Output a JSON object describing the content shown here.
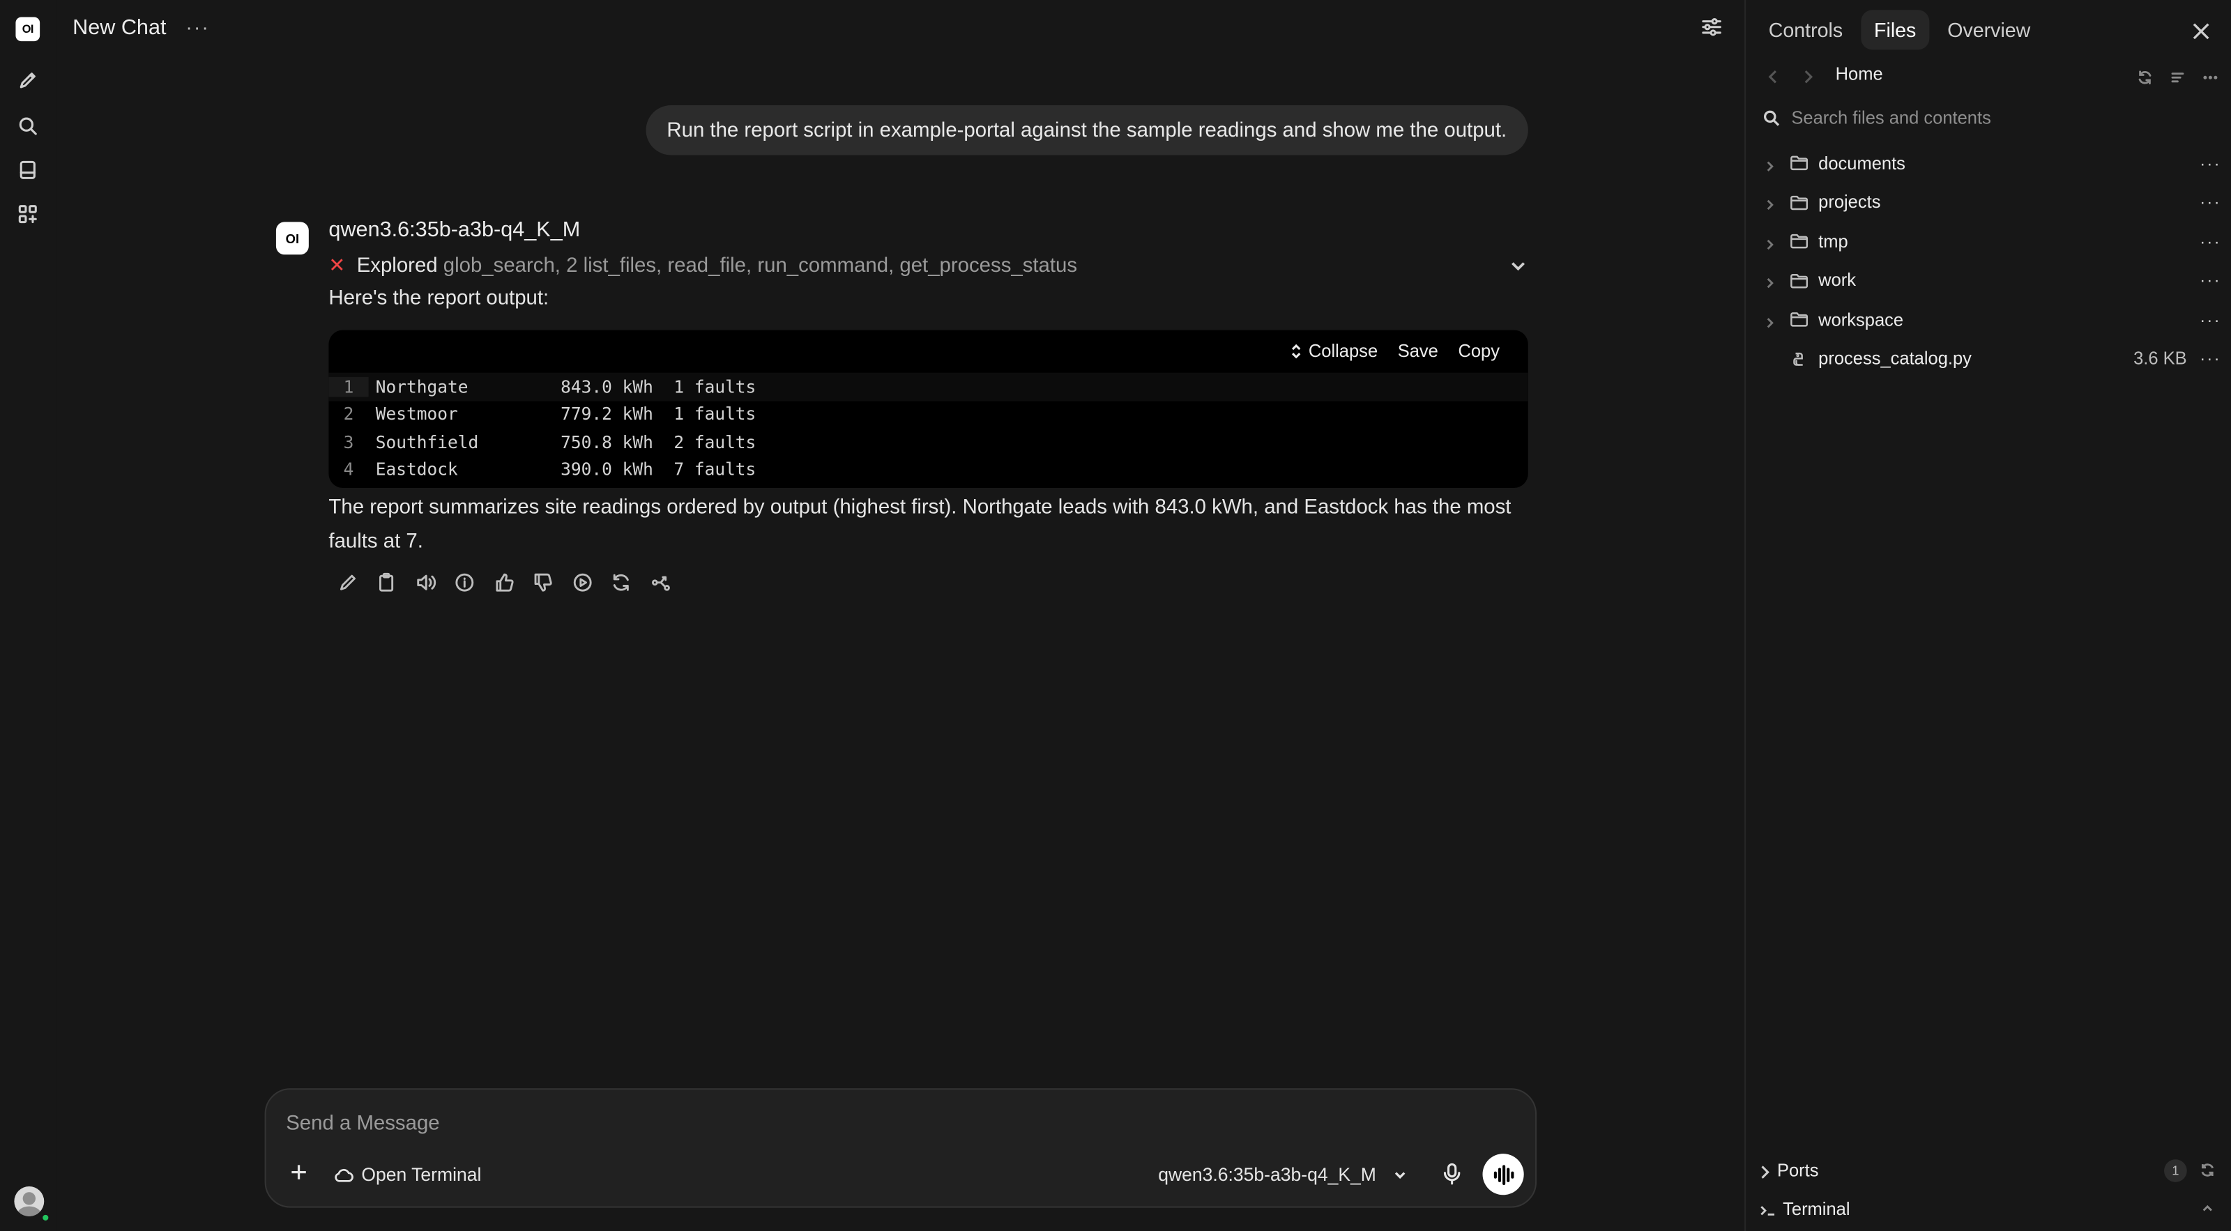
{
  "header": {
    "title": "New Chat",
    "more_icon": "ellipsis-icon",
    "settings_icon": "sliders-icon"
  },
  "rail": {
    "logo": "OI",
    "icons": [
      "new-chat-icon",
      "search-icon",
      "notes-icon",
      "workspace-icon"
    ]
  },
  "conversation": {
    "user_message": "Run the report script in example-portal against the sample readings and show me the output.",
    "assistant": {
      "avatar_text": "OI",
      "model": "qwen3.6:35b-a3b-q4_K_M",
      "explored_label": "Explored",
      "explored_tools": "glob_search, 2 list_files, read_file, run_command, get_process_status",
      "intro": "Here's the report output:",
      "code": {
        "actions": {
          "collapse": "Collapse",
          "save": "Save",
          "copy": "Copy"
        },
        "lines": [
          {
            "n": "1",
            "text": "Northgate         843.0 kWh  1 faults"
          },
          {
            "n": "2",
            "text": "Westmoor          779.2 kWh  1 faults"
          },
          {
            "n": "3",
            "text": "Southfield        750.8 kWh  2 faults"
          },
          {
            "n": "4",
            "text": "Eastdock          390.0 kWh  7 faults"
          }
        ]
      },
      "summary": "The report summarizes site readings ordered by output (highest first). Northgate leads with 843.0 kWh, and Eastdock has the most faults at 7.",
      "actions": [
        "edit-icon",
        "copy-icon",
        "read-aloud-icon",
        "info-icon",
        "thumbs-up-icon",
        "thumbs-down-icon",
        "continue-icon",
        "regenerate-icon",
        "branch-icon"
      ]
    }
  },
  "composer": {
    "placeholder": "Send a Message",
    "open_terminal": "Open Terminal",
    "model": "qwen3.6:35b-a3b-q4_K_M"
  },
  "panel": {
    "tabs": [
      "Controls",
      "Files",
      "Overview"
    ],
    "active_tab": "Files",
    "breadcrumb": "Home",
    "search_placeholder": "Search files and contents",
    "items": [
      {
        "name": "documents",
        "type": "folder"
      },
      {
        "name": "projects",
        "type": "folder"
      },
      {
        "name": "tmp",
        "type": "folder"
      },
      {
        "name": "work",
        "type": "folder"
      },
      {
        "name": "workspace",
        "type": "folder"
      },
      {
        "name": "process_catalog.py",
        "type": "file",
        "size": "3.6 KB"
      }
    ],
    "ports": {
      "label": "Ports",
      "count": "1"
    },
    "terminal": {
      "label": "Terminal"
    }
  }
}
